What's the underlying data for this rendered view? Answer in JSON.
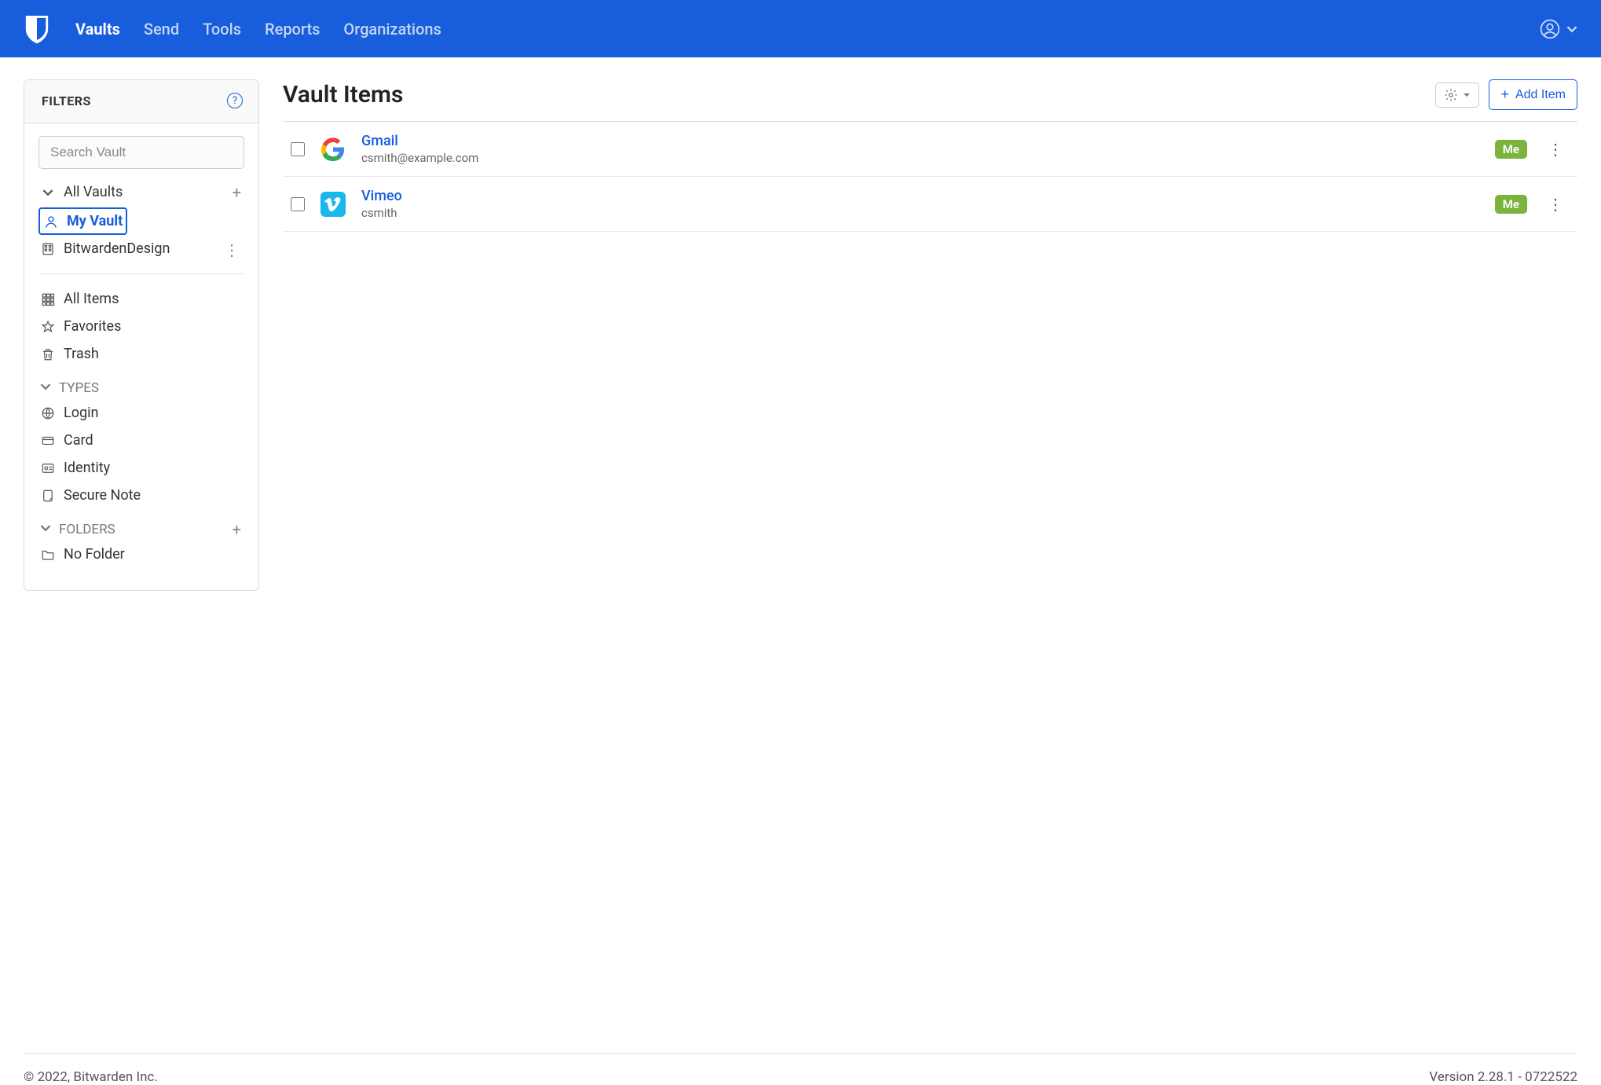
{
  "nav": {
    "items": [
      "Vaults",
      "Send",
      "Tools",
      "Reports",
      "Organizations"
    ],
    "activeIndex": 0
  },
  "sidebar": {
    "title": "FILTERS",
    "search_placeholder": "Search Vault",
    "vaults": {
      "root": "All Vaults",
      "children": [
        {
          "label": "My Vault",
          "selected": true
        },
        {
          "label": "BitwardenDesign",
          "more": true
        }
      ]
    },
    "items": [
      "All Items",
      "Favorites",
      "Trash"
    ],
    "types_header": "TYPES",
    "types": [
      "Login",
      "Card",
      "Identity",
      "Secure Note"
    ],
    "folders_header": "FOLDERS",
    "folders": [
      "No Folder"
    ]
  },
  "main": {
    "title": "Vault Items",
    "add_label": "Add Item",
    "items": [
      {
        "name": "Gmail",
        "subtitle": "csmith@example.com",
        "badge": "Me",
        "icon": "google"
      },
      {
        "name": "Vimeo",
        "subtitle": "csmith",
        "badge": "Me",
        "icon": "vimeo"
      }
    ]
  },
  "footer": {
    "copyright": "© 2022, Bitwarden Inc.",
    "version": "Version 2.28.1 - 0722522"
  }
}
